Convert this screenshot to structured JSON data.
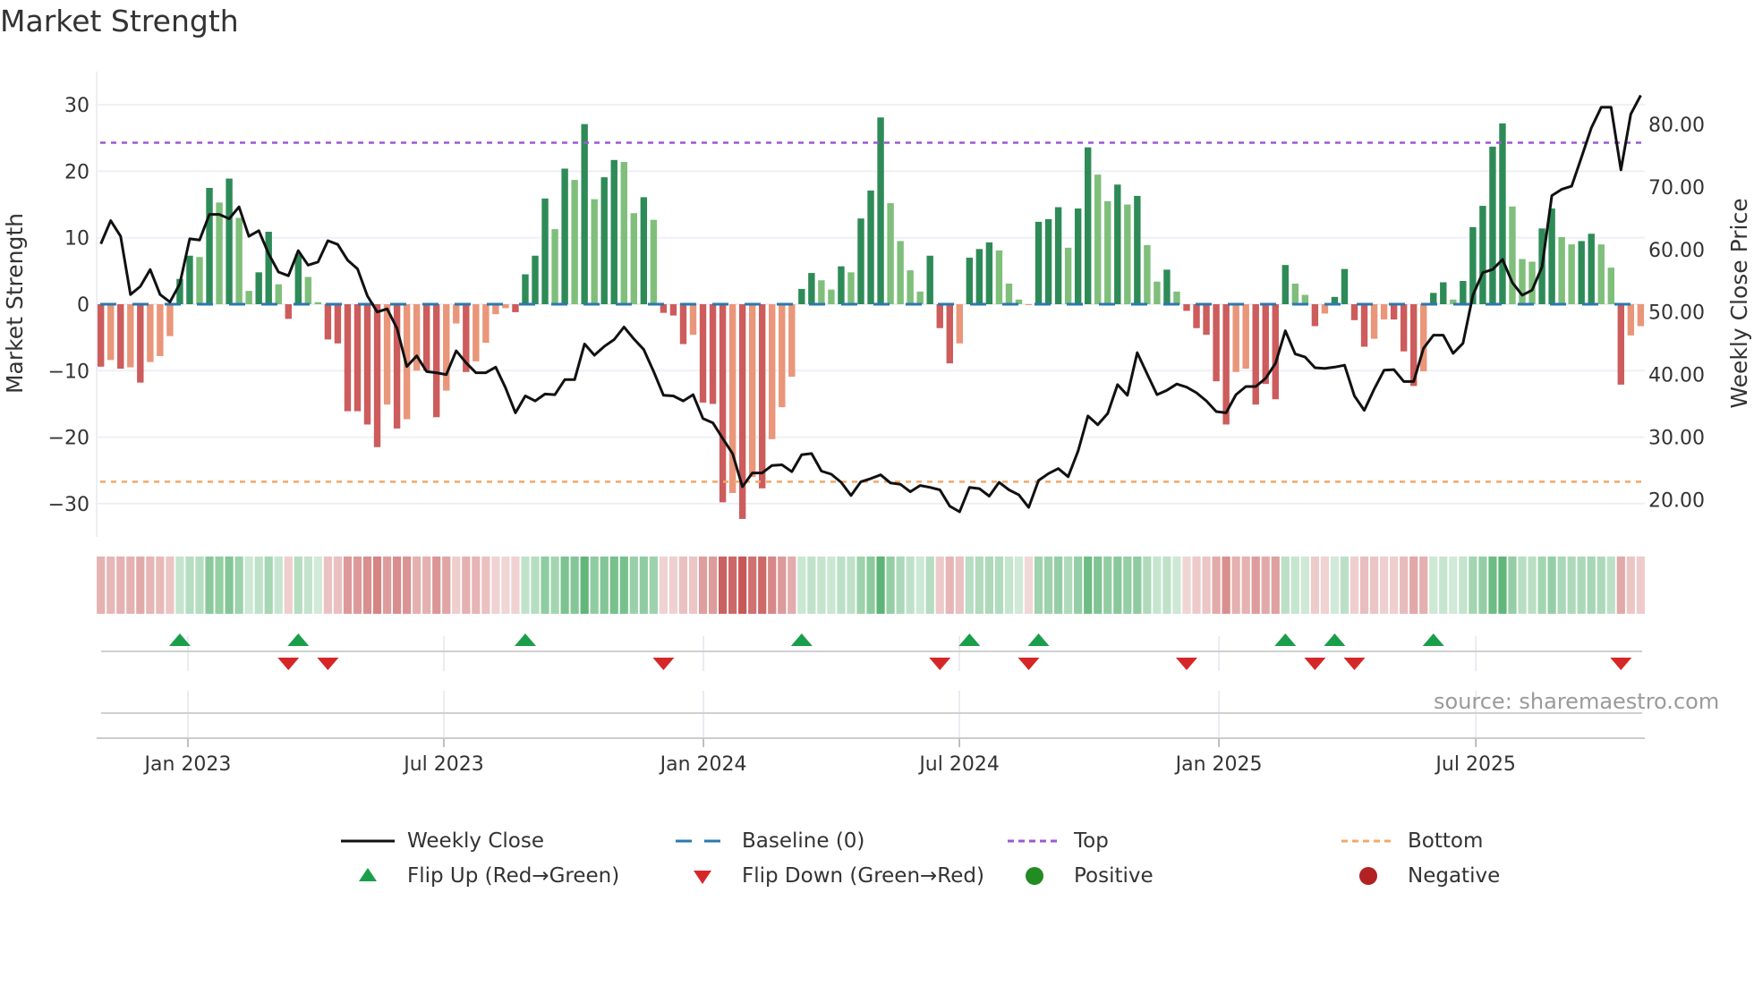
{
  "title": "Market Strength",
  "source": "source: sharemaestro.com",
  "legend": {
    "weekly_close": "Weekly Close",
    "baseline": "Baseline (0)",
    "top": "Top",
    "bottom": "Bottom",
    "flip_up": "Flip Up (Red→Green)",
    "flip_down": "Flip Down (Green→Red)",
    "positive": "Positive",
    "negative": "Negative"
  },
  "colors": {
    "strong_green": "#2e8b57",
    "weak_green": "#7fbf7b",
    "strong_red": "#cd5c5c",
    "weak_red": "#e9967a",
    "baseline": "#2b78b0",
    "top": "#9b59d6",
    "bottom": "#f0a868",
    "line": "#111111",
    "flip_up": "#1a9e4a",
    "flip_down": "#d62728",
    "positive": "#228b22",
    "negative": "#b22222"
  },
  "chart_data": {
    "type": "bar",
    "title": "Market Strength",
    "ylabel": "Market Strength",
    "y2label": "Weekly Close Price",
    "ylim": [
      -35,
      35
    ],
    "y2lim": [
      14.1,
      88.4
    ],
    "yticks": [
      30,
      20,
      10,
      0,
      -10,
      -20,
      -30
    ],
    "yticklabels": [
      "30",
      "20",
      "10",
      "0",
      "−10",
      "−20",
      "−30"
    ],
    "y2ticks": [
      80,
      70,
      60,
      50,
      40,
      30,
      20
    ],
    "y2ticklabels": [
      "80.00",
      "70.00",
      "60.00",
      "50.00",
      "40.00",
      "30.00",
      "20.00"
    ],
    "x_unit": "week index (weekly bars)",
    "xticks": [
      {
        "label": "Jan 2023",
        "week": 8.82
      },
      {
        "label": "Jul 2023",
        "week": 34.75
      },
      {
        "label": "Jan 2024",
        "week": 61.05
      },
      {
        "label": "Jul 2024",
        "week": 86.98
      },
      {
        "label": "Jan 2025",
        "week": 113.27
      },
      {
        "label": "Jul 2025",
        "week": 139.3
      }
    ],
    "top_level": 24.3,
    "bottom_level": -26.7,
    "baseline": 0,
    "strength": [
      -9.4,
      -8.4,
      -9.7,
      -9.5,
      -11.8,
      -8.7,
      -7.8,
      -4.8,
      3.8,
      7.3,
      7.1,
      17.5,
      15.3,
      18.9,
      13.0,
      2.0,
      4.8,
      10.9,
      3.0,
      -2.2,
      7.5,
      4.1,
      0.3,
      -5.3,
      -5.9,
      -16.1,
      -16.1,
      -18.1,
      -21.5,
      -15.1,
      -18.7,
      -17.3,
      -10.0,
      -10.0,
      -17.0,
      -13.0,
      -2.9,
      -10.2,
      -8.6,
      -5.8,
      -1.5,
      -0.6,
      -1.2,
      4.5,
      7.3,
      15.9,
      11.3,
      20.4,
      18.7,
      27.1,
      15.8,
      19.1,
      21.7,
      21.4,
      13.7,
      16.1,
      12.7,
      -1.3,
      -1.7,
      -6.0,
      -4.6,
      -14.8,
      -15.0,
      -29.8,
      -28.4,
      -32.3,
      -26.0,
      -27.7,
      -20.3,
      -15.5,
      -10.9,
      2.3,
      4.7,
      3.6,
      2.2,
      5.7,
      4.8,
      12.9,
      17.1,
      28.1,
      15.2,
      9.5,
      5.1,
      1.9,
      7.3,
      -3.6,
      -8.9,
      -5.9,
      7.0,
      8.3,
      9.3,
      8.1,
      3.1,
      0.7,
      -0.1,
      12.4,
      12.8,
      14.6,
      8.5,
      14.4,
      23.6,
      19.5,
      15.5,
      18.0,
      15.0,
      16.3,
      8.9,
      3.4,
      5.2,
      1.9,
      -1.0,
      -3.6,
      -4.6,
      -11.6,
      -18.1,
      -10.2,
      -9.7,
      -15.1,
      -12.0,
      -14.3,
      5.9,
      3.1,
      1.4,
      -3.3,
      -1.4,
      1.1,
      5.3,
      -2.4,
      -6.4,
      -5.2,
      -2.3,
      -2.3,
      -7.1,
      -12.3,
      -10.1,
      1.7,
      3.3,
      0.7,
      3.5,
      11.6,
      14.8,
      23.7,
      27.2,
      14.7,
      6.8,
      6.4,
      11.4,
      14.4,
      10.1,
      9.0,
      9.5,
      10.6,
      9.0,
      5.5,
      -12.1,
      -4.7,
      -3.3
    ],
    "strong": [
      1,
      0,
      1,
      0,
      1,
      0,
      0,
      0,
      1,
      1,
      0,
      1,
      0,
      1,
      0,
      0,
      1,
      1,
      0,
      1,
      1,
      0,
      0,
      1,
      1,
      1,
      1,
      1,
      1,
      0,
      1,
      0,
      0,
      1,
      1,
      0,
      0,
      1,
      0,
      0,
      0,
      0,
      1,
      1,
      1,
      1,
      0,
      1,
      0,
      1,
      0,
      1,
      1,
      0,
      0,
      1,
      0,
      1,
      1,
      1,
      0,
      1,
      1,
      1,
      0,
      1,
      0,
      1,
      0,
      0,
      0,
      1,
      1,
      0,
      0,
      1,
      0,
      1,
      1,
      1,
      0,
      0,
      0,
      0,
      1,
      1,
      1,
      0,
      1,
      1,
      1,
      0,
      0,
      0,
      0,
      1,
      1,
      1,
      0,
      1,
      1,
      0,
      0,
      1,
      0,
      1,
      0,
      0,
      1,
      0,
      1,
      1,
      1,
      1,
      1,
      0,
      0,
      1,
      1,
      1,
      1,
      0,
      0,
      1,
      0,
      1,
      1,
      1,
      1,
      0,
      0,
      1,
      1,
      1,
      0,
      1,
      1,
      0,
      1,
      1,
      1,
      1,
      1,
      0,
      0,
      0,
      1,
      1,
      0,
      0,
      1,
      1,
      0,
      0,
      1,
      0,
      0
    ],
    "weekly_close": [
      60.9,
      64.6,
      62.1,
      52.8,
      54.1,
      56.8,
      52.8,
      51.6,
      54.5,
      61.7,
      61.5,
      65.6,
      65.6,
      64.9,
      66.8,
      62.1,
      63.0,
      59.3,
      56.4,
      55.8,
      59.8,
      57.5,
      58.0,
      61.4,
      60.8,
      58.3,
      56.9,
      52.6,
      50.0,
      50.5,
      47.4,
      41.3,
      43.0,
      40.5,
      40.3,
      40.0,
      43.8,
      41.9,
      40.3,
      40.3,
      41.2,
      37.9,
      33.9,
      36.6,
      35.8,
      36.9,
      36.8,
      39.2,
      39.2,
      44.9,
      43.1,
      44.5,
      45.6,
      47.6,
      45.7,
      44.0,
      40.5,
      36.7,
      36.6,
      35.8,
      36.8,
      33.0,
      32.3,
      29.8,
      27.4,
      22.1,
      24.3,
      24.3,
      25.5,
      25.6,
      24.5,
      27.2,
      27.4,
      24.6,
      24.1,
      22.8,
      20.7,
      22.9,
      23.4,
      24.0,
      22.7,
      22.5,
      21.3,
      22.3,
      22.0,
      21.6,
      19.0,
      18.1,
      22.0,
      21.8,
      20.6,
      22.8,
      21.6,
      20.8,
      18.8,
      23.1,
      24.2,
      25.0,
      23.7,
      27.8,
      33.4,
      32.0,
      33.8,
      38.4,
      36.7,
      43.5,
      40.1,
      36.8,
      37.5,
      38.5,
      38.0,
      37.1,
      35.8,
      34.1,
      33.9,
      36.8,
      38.1,
      38.1,
      39.4,
      41.8,
      47.0,
      43.3,
      42.8,
      41.1,
      41.0,
      41.2,
      41.5,
      36.6,
      34.3,
      37.7,
      40.7,
      40.8,
      38.9,
      38.9,
      44.2,
      46.3,
      46.3,
      43.4,
      45.0,
      52.7,
      56.3,
      56.8,
      58.4,
      54.7,
      52.7,
      53.5,
      57.2,
      68.6,
      69.6,
      70.1,
      74.7,
      79.4,
      82.7,
      82.7,
      72.7,
      81.6,
      84.6
    ]
  }
}
